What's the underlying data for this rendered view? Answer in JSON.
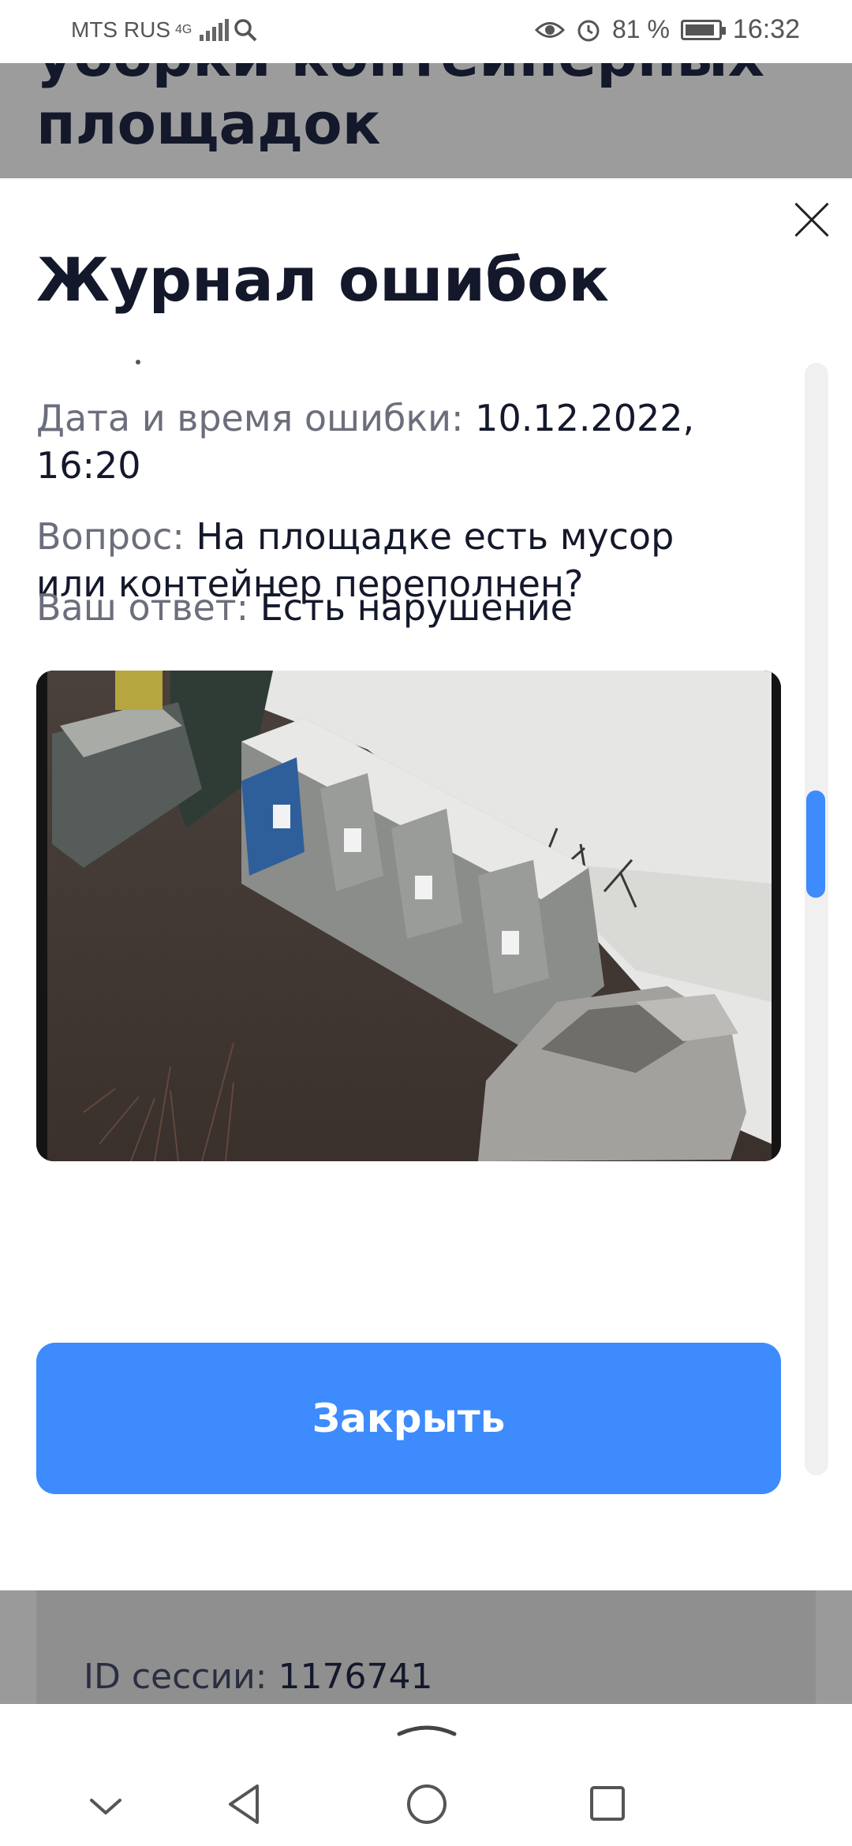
{
  "status_bar": {
    "carrier": "MTS RUS",
    "network": "4G",
    "battery": "81 %",
    "time": "16:32",
    "battery_level": 0.81
  },
  "background_page": {
    "title_lines": "уборки контейнерных\nплощадок",
    "session_label": "ID сессии:",
    "session_value": "1176741"
  },
  "modal": {
    "title": "Журнал ошибок",
    "fields": [
      {
        "label": "Дата и время ошибки:",
        "value": "10.12.2022, 16:20"
      },
      {
        "label": "Вопрос:",
        "value": "На площадке есть мусор или контейнер переполнен?"
      },
      {
        "label": "Ваш ответ:",
        "value": "Есть нарушение"
      }
    ],
    "close_button": "Закрыть"
  },
  "colors": {
    "accent": "#3d8bfd",
    "text_dark": "#14182b",
    "text_muted": "#6b6e7b"
  },
  "icons": [
    "search-icon",
    "eye-icon",
    "alarm-icon",
    "battery-icon",
    "close-icon",
    "chevron-down-icon",
    "back-icon",
    "home-icon",
    "recents-icon",
    "expand-handle-icon"
  ]
}
